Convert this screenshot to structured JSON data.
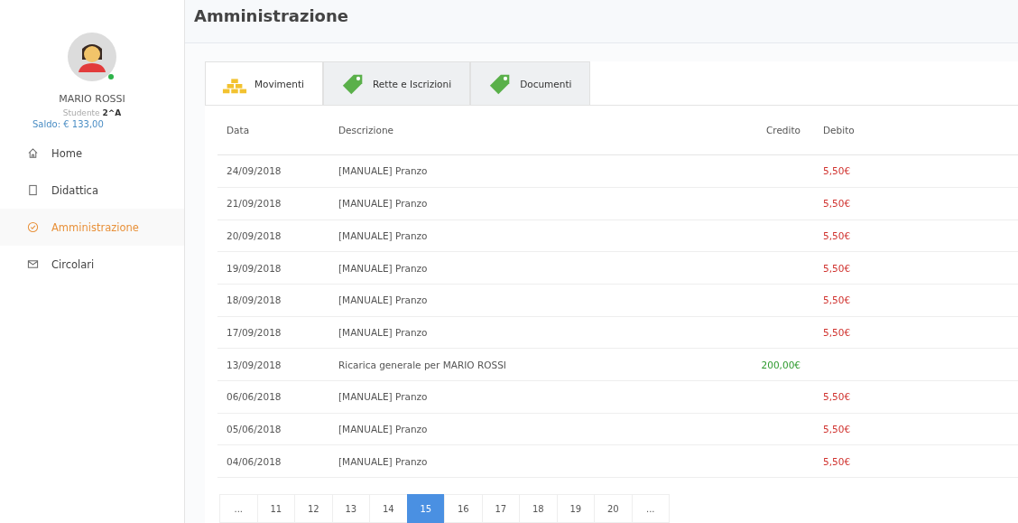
{
  "sidebar": {
    "user": {
      "name": "MARIO ROSSI",
      "role": "Studente **2^A**",
      "balance": "Saldo: € 133,00",
      "online": true
    },
    "items": [
      {
        "label": "Home",
        "kind": "home",
        "selected": false
      },
      {
        "label": "Didattica",
        "kind": "book",
        "selected": false
      },
      {
        "label": "Amministrazione",
        "kind": "check",
        "selected": true
      },
      {
        "label": "Circolari",
        "kind": "mail",
        "selected": false
      }
    ]
  },
  "header": {
    "title": "Amministrazione"
  },
  "tabs": [
    {
      "label": "Movimenti",
      "kind": "bars",
      "selected": true
    },
    {
      "label": "Rette e Iscrizioni",
      "kind": "tag",
      "selected": false
    },
    {
      "label": "Documenti",
      "kind": "tag",
      "selected": false
    }
  ],
  "table": {
    "columns": [
      "Data",
      "Descrizione",
      "Credito",
      "Debito"
    ],
    "rows": [
      {
        "date": "24/09/2018",
        "description": "[MANUALE] Pranzo",
        "credit": "",
        "debit": "5,50€"
      },
      {
        "date": "21/09/2018",
        "description": "[MANUALE] Pranzo",
        "credit": "",
        "debit": "5,50€"
      },
      {
        "date": "20/09/2018",
        "description": "[MANUALE] Pranzo",
        "credit": "",
        "debit": "5,50€"
      },
      {
        "date": "19/09/2018",
        "description": "[MANUALE] Pranzo",
        "credit": "",
        "debit": "5,50€"
      },
      {
        "date": "18/09/2018",
        "description": "[MANUALE] Pranzo",
        "credit": "",
        "debit": "5,50€"
      },
      {
        "date": "17/09/2018",
        "description": "[MANUALE] Pranzo",
        "credit": "",
        "debit": "5,50€"
      },
      {
        "date": "13/09/2018",
        "description": "Ricarica generale per MARIO ROSSI",
        "credit": "200,00€",
        "debit": ""
      },
      {
        "date": "06/06/2018",
        "description": "[MANUALE] Pranzo",
        "credit": "",
        "debit": "5,50€"
      },
      {
        "date": "05/06/2018",
        "description": "[MANUALE] Pranzo",
        "credit": "",
        "debit": "5,50€"
      },
      {
        "date": "04/06/2018",
        "description": "[MANUALE] Pranzo",
        "credit": "",
        "debit": "5,50€"
      }
    ]
  },
  "pagination": [
    {
      "label": "...",
      "selected": false
    },
    {
      "label": "11",
      "selected": false
    },
    {
      "label": "12",
      "selected": false
    },
    {
      "label": "13",
      "selected": false
    },
    {
      "label": "14",
      "selected": false
    },
    {
      "label": "15",
      "selected": true
    },
    {
      "label": "16",
      "selected": false
    },
    {
      "label": "17",
      "selected": false
    },
    {
      "label": "18",
      "selected": false
    },
    {
      "label": "19",
      "selected": false
    },
    {
      "label": "20",
      "selected": false
    },
    {
      "label": "...",
      "selected": false
    }
  ]
}
